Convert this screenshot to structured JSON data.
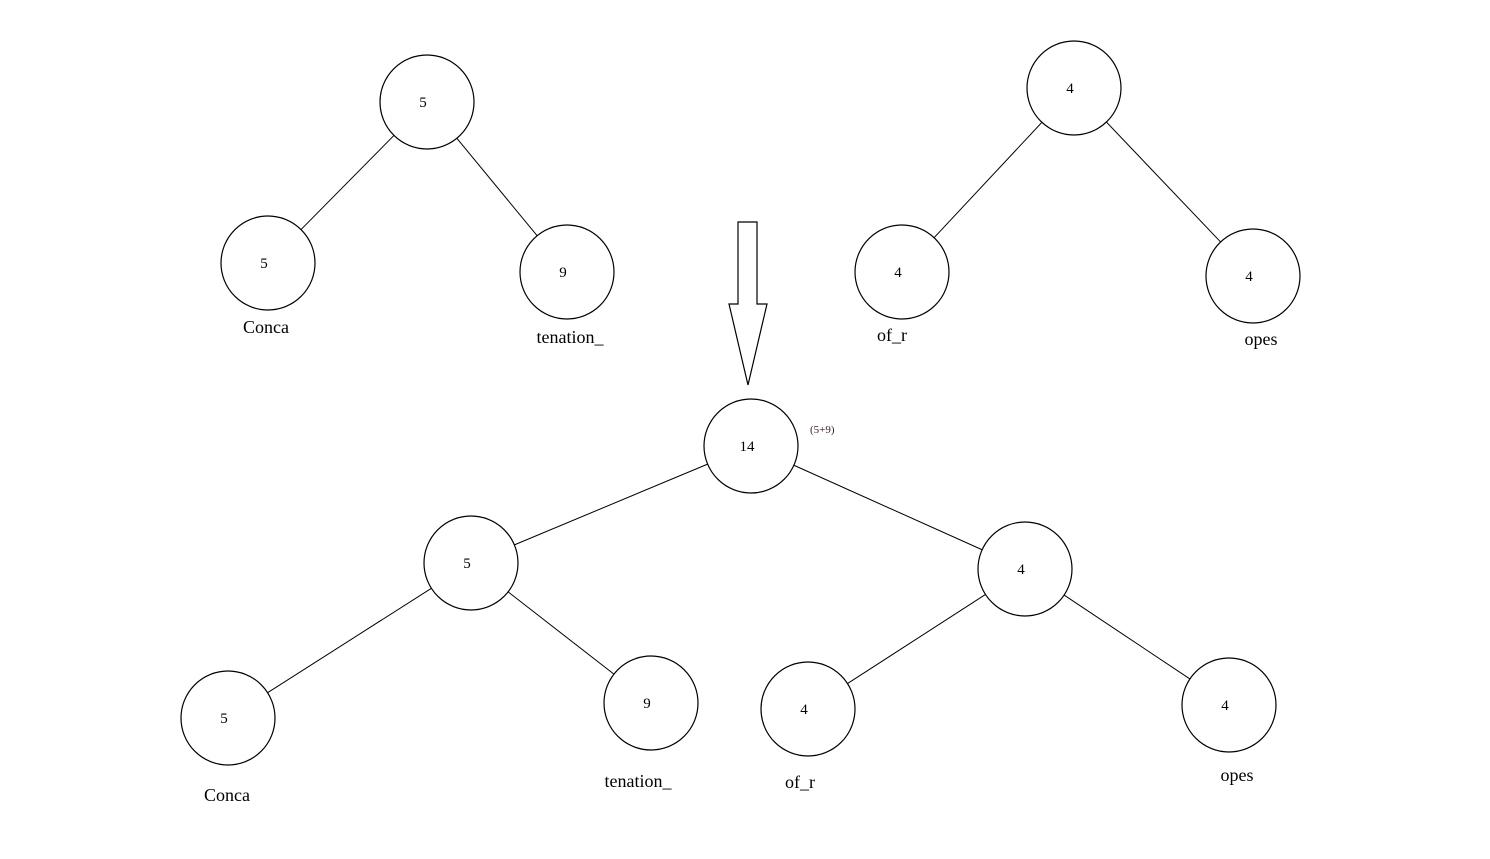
{
  "trees": {
    "top_left": {
      "nodes": [
        {
          "id": "tl_root",
          "value": "5"
        },
        {
          "id": "tl_a",
          "value": "5",
          "label": "Conca"
        },
        {
          "id": "tl_b",
          "value": "9",
          "label": "tenation_"
        }
      ],
      "edges": [
        [
          "tl_root",
          "tl_a"
        ],
        [
          "tl_root",
          "tl_b"
        ]
      ]
    },
    "top_right": {
      "nodes": [
        {
          "id": "tr_root",
          "value": "4"
        },
        {
          "id": "tr_a",
          "value": "4",
          "label": "of_r"
        },
        {
          "id": "tr_b",
          "value": "4",
          "label": "opes"
        }
      ],
      "edges": [
        [
          "tr_root",
          "tr_a"
        ],
        [
          "tr_root",
          "tr_b"
        ]
      ]
    },
    "merged": {
      "root_annotation": "(5+9)",
      "nodes": [
        {
          "id": "m_root",
          "value": "14"
        },
        {
          "id": "m_l",
          "value": "5"
        },
        {
          "id": "m_r",
          "value": "4"
        },
        {
          "id": "m_la",
          "value": "5",
          "label": "Conca"
        },
        {
          "id": "m_lb",
          "value": "9",
          "label": "tenation_"
        },
        {
          "id": "m_ra",
          "value": "4",
          "label": "of_r"
        },
        {
          "id": "m_rb",
          "value": "4",
          "label": "opes"
        }
      ],
      "edges": [
        [
          "m_root",
          "m_l"
        ],
        [
          "m_root",
          "m_r"
        ],
        [
          "m_l",
          "m_la"
        ],
        [
          "m_l",
          "m_lb"
        ],
        [
          "m_r",
          "m_ra"
        ],
        [
          "m_r",
          "m_rb"
        ]
      ]
    }
  },
  "arrow": {
    "direction": "down",
    "meaning": "merge"
  }
}
